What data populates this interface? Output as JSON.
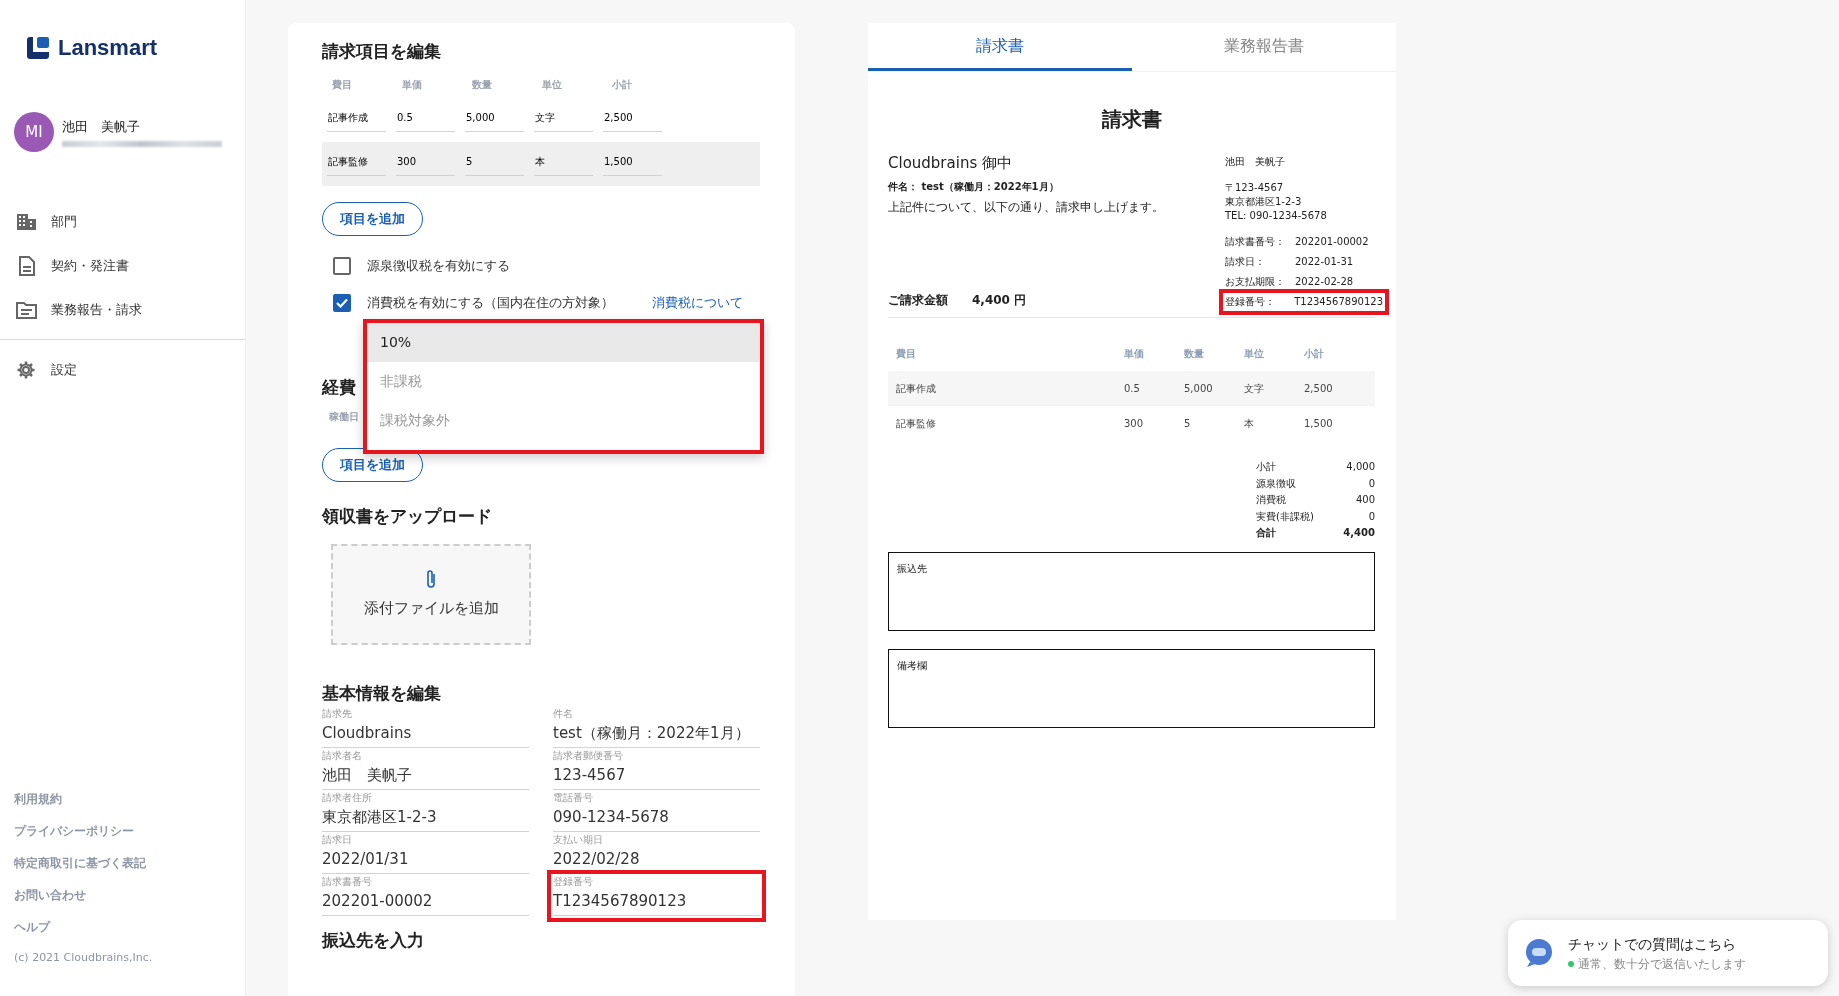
{
  "sidebar": {
    "logo": "Lansmart",
    "user": {
      "initials": "MI",
      "name": "池田　美帆子"
    },
    "nav": [
      {
        "label": "部門",
        "divider_after": false
      },
      {
        "label": "契約・発注書",
        "divider_after": false
      },
      {
        "label": "業務報告・請求",
        "divider_after": true
      },
      {
        "label": "設定",
        "divider_after": false
      }
    ],
    "footer_links": [
      "利用規約",
      "プライバシーポリシー",
      "特定商取引に基づく表記",
      "お問い合わせ",
      "ヘルプ"
    ],
    "copyright": "(c) 2021 Cloudbrains,Inc."
  },
  "editor": {
    "title": "請求項目を編集",
    "columns": [
      "費目",
      "単価",
      "数量",
      "単位",
      "小計"
    ],
    "rows": [
      {
        "cells": [
          "記事作成",
          "0.5",
          "5,000",
          "文字",
          "2,500"
        ],
        "hovered": false
      },
      {
        "cells": [
          "記事監修",
          "300",
          "5",
          "本",
          "1,500"
        ],
        "hovered": true
      }
    ],
    "add_button": "項目を追加",
    "options": [
      {
        "label": "源泉徴収税を有効にする",
        "checked": false
      },
      {
        "label": "消費税を有効にする（国内在住の方対象）",
        "checked": true,
        "link": "消費税について"
      }
    ],
    "tax_dropdown": {
      "highlighted": true,
      "options": [
        {
          "label": "10%",
          "selected": true
        },
        {
          "label": "非課税",
          "selected": false
        },
        {
          "label": "課税対象外",
          "selected": false
        }
      ]
    },
    "expenses": {
      "title": "経費",
      "column_1": "稼働日",
      "add_button": "項目を追加"
    },
    "upload": {
      "title": "領収書をアップロード",
      "button": "添付ファイルを追加"
    },
    "basic": {
      "title": "基本情報を編集",
      "fields": [
        {
          "label": "請求先",
          "value": "Cloudbrains",
          "highlighted": false
        },
        {
          "label": "件名",
          "value": "test（稼働月：2022年1月）",
          "highlighted": false
        },
        {
          "label": "請求者名",
          "value": "池田　美帆子",
          "highlighted": false
        },
        {
          "label": "請求者郵便番号",
          "value": "123-4567",
          "highlighted": false
        },
        {
          "label": "請求者住所",
          "value": "東京都港区1-2-3",
          "highlighted": false
        },
        {
          "label": "電話番号",
          "value": "090-1234-5678",
          "highlighted": false
        },
        {
          "label": "請求日",
          "value": "2022/01/31",
          "highlighted": false
        },
        {
          "label": "支払い期日",
          "value": "2022/02/28",
          "highlighted": false
        },
        {
          "label": "請求書番号",
          "value": "202201-00002",
          "highlighted": false
        },
        {
          "label": "登録番号",
          "value": "T1234567890123",
          "highlighted": true
        }
      ]
    },
    "next_section": "振込先を入力"
  },
  "preview": {
    "tabs": [
      {
        "label": "請求書",
        "selected": true
      },
      {
        "label": "業務報告書",
        "selected": false
      }
    ],
    "invoice": {
      "title": "請求書",
      "client": "Cloudbrains 御中",
      "subject": "件名： test（稼働月：2022年1月）",
      "message": "上記件について、以下の通り、請求申し上げます。",
      "sender_name": "池田　美帆子",
      "sender_lines": [
        "〒123-4567",
        "東京都港区1-2-3",
        "TEL: 090-1234-5678"
      ],
      "details": [
        {
          "label": "請求書番号：",
          "value": "202201-00002",
          "highlighted": false
        },
        {
          "label": "請求日：",
          "value": "2022-01-31",
          "highlighted": false
        },
        {
          "label": "お支払期限：",
          "value": "2022-02-28",
          "highlighted": false
        },
        {
          "label": "登録番号：",
          "value": "T1234567890123",
          "highlighted": true
        }
      ],
      "total_label": "ご請求金額",
      "total_value": "4,400 円",
      "columns": [
        "費目",
        "単価",
        "数量",
        "単位",
        "小計"
      ],
      "rows": [
        [
          "記事作成",
          "0.5",
          "5,000",
          "文字",
          "2,500"
        ],
        [
          "記事監修",
          "300",
          "5",
          "本",
          "1,500"
        ]
      ],
      "summary": [
        {
          "label": "小計",
          "value": "4,000",
          "bold": false
        },
        {
          "label": "源泉徴収",
          "value": "0",
          "bold": false
        },
        {
          "label": "消費税",
          "value": "400",
          "bold": false
        },
        {
          "label": "実費(非課税)",
          "value": "0",
          "bold": false
        },
        {
          "label": "合計",
          "value": "4,400",
          "bold": true
        }
      ],
      "boxes": [
        "振込先",
        "備考欄"
      ]
    }
  },
  "chat": {
    "title": "チャットでの質問はこちら",
    "status": "通常、数十分で返信いたします",
    "online": true
  }
}
